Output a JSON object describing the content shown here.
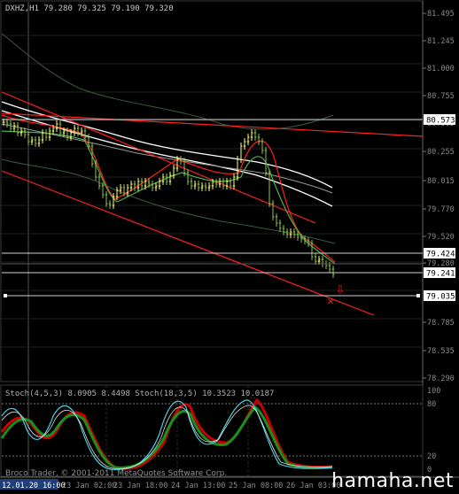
{
  "main_chart": {
    "header": "DXHZ,H1  79.280 79.325 79.190 79.320",
    "price_axis": [
      "81.495",
      "81.245",
      "81.000",
      "80.755",
      "80.505",
      "80.255",
      "80.015",
      "79.770",
      "79.520",
      "79.280",
      "78.785",
      "78.535",
      "78.290"
    ],
    "price_labels": [
      {
        "text": "80.573",
        "box_bg": "#ffffff",
        "box_fg": "#000000"
      },
      {
        "text": "79.424",
        "box_bg": "#ffffff",
        "box_fg": "#000000"
      },
      {
        "text": "79.241",
        "box_bg": "#ffffff",
        "box_fg": "#000000"
      },
      {
        "text": "79.035",
        "box_bg": "#ffffff",
        "box_fg": "#000000"
      }
    ]
  },
  "stoch_panel": {
    "header": "Stoch(4,5,3) 8.0905 8.4498   Stoch(18,3,5) 10.3523 10.0187",
    "axis": [
      "100",
      "80",
      "20",
      "0"
    ],
    "copyright": "Broco Trader, © 2001-2011 MetaQuotes Software Corp."
  },
  "time_axis": [
    "12.01.20 16:00",
    "23 Jan 02:00",
    "23 Jan 18:00",
    "24 Jan 13:00",
    "25 Jan 08:00",
    "26 Jan 03:00"
  ],
  "watermark": "hamaha.net",
  "colors": {
    "background": "#000000",
    "grid": "#2a2a2a",
    "axis_text": "#8a8a8a",
    "bull_candle": "#ffff66",
    "bear_candle": "#8bc34a",
    "channel": "#ff2020",
    "ma_white": "#ffffff",
    "ma_green": "#4caf50",
    "stoch_red": "#cc0000",
    "stoch_green": "#1a8f1a",
    "stoch_cyan": "#4dd0e1"
  }
}
